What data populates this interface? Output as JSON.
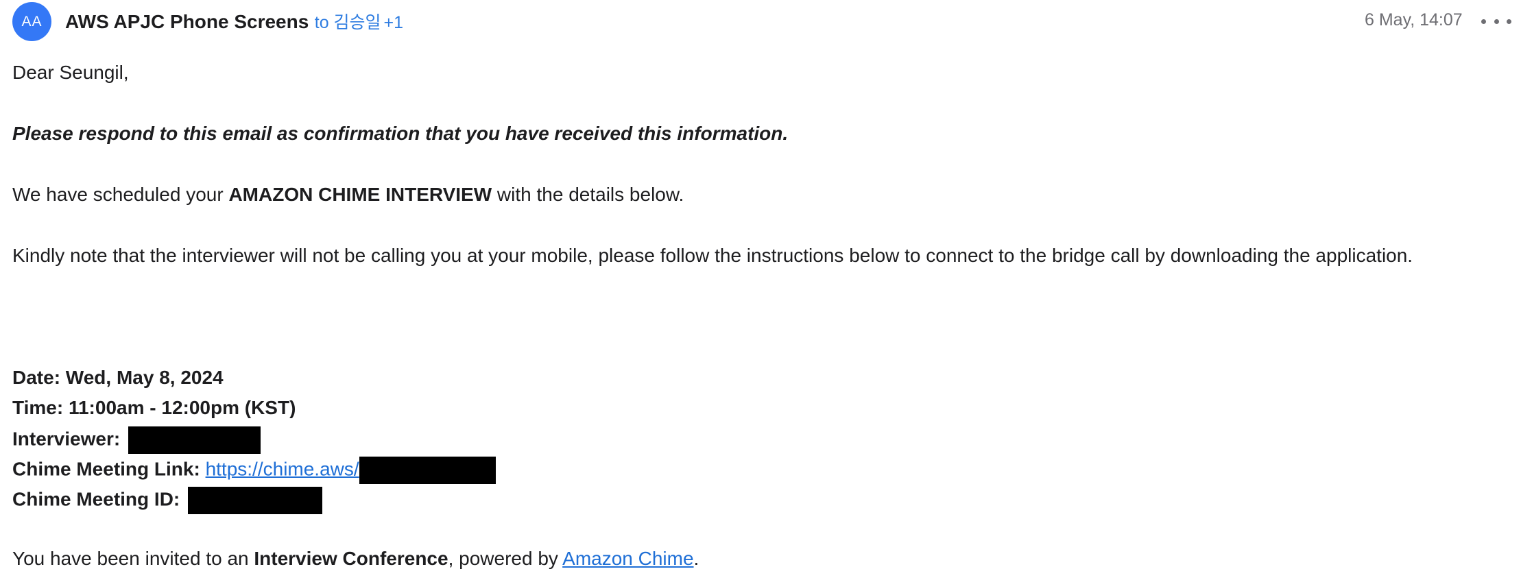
{
  "header": {
    "avatar_initials": "AA",
    "sender_name": "AWS APJC Phone Screens",
    "to_label": "to 김승일",
    "extra_recipients": "+1",
    "timestamp": "6 May, 14:07",
    "more_icon": "more-horizontal-icon"
  },
  "body": {
    "greeting": "Dear Seungil,",
    "confirmation_request": "Please respond to this email as confirmation that you have received this information.",
    "scheduled_prefix": "We have scheduled your ",
    "scheduled_highlight": "AMAZON CHIME INTERVIEW",
    "scheduled_suffix": " with the details below.",
    "note": "Kindly note that the interviewer will not be calling you at your mobile, please follow the instructions below to connect to the bridge call by downloading the application.",
    "details": {
      "date": "Date: Wed, May 8, 2024",
      "time": "Time: 11:00am - 12:00pm (KST)",
      "interviewer_label": "Interviewer:",
      "meeting_link_label": "Chime Meeting Link:",
      "meeting_link_text": "https://chime.aws/",
      "meeting_id_label": "Chime Meeting ID:"
    },
    "invite_prefix": "You have been invited to an ",
    "invite_highlight": "Interview Conference",
    "invite_middle": ", powered by ",
    "invite_link": "Amazon Chime",
    "invite_suffix": "."
  },
  "colors": {
    "avatar": "#3478f6",
    "recipient_text": "#2f7de1",
    "link": "#1f6fd6",
    "timestamp": "#6e6e73",
    "redaction": "#000000"
  }
}
